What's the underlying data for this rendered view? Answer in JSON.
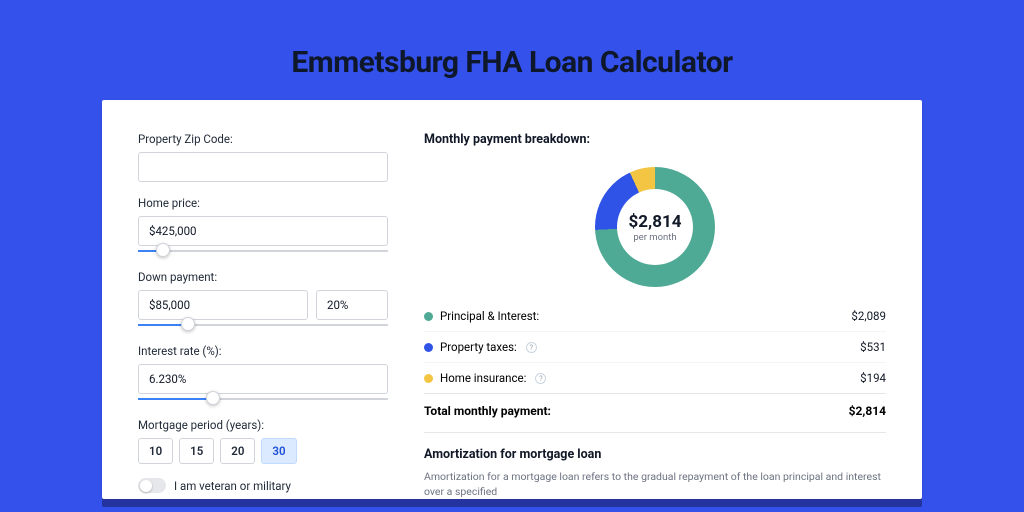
{
  "title": "Emmetsburg FHA Loan Calculator",
  "labels": {
    "zip": "Property Zip Code:",
    "home_price": "Home price:",
    "down_payment": "Down payment:",
    "interest_rate": "Interest rate (%):",
    "mortgage_period": "Mortgage period (years):",
    "veteran": "I am veteran or military"
  },
  "inputs": {
    "zip": "",
    "home_price": "$425,000",
    "down_payment": "$85,000",
    "down_payment_pct": "20%",
    "interest_rate": "6.230%"
  },
  "sliders": {
    "home_price_pct": 10,
    "down_payment_pct": 20,
    "interest_rate_pct": 30
  },
  "periods": [
    "10",
    "15",
    "20",
    "30"
  ],
  "period_active": "30",
  "colors": {
    "principal": "#4ea995",
    "taxes": "#2e53e6",
    "insurance": "#f4c542"
  },
  "breakdown": {
    "title": "Monthly payment breakdown:",
    "total": "$2,814",
    "total_sub": "per month",
    "items": [
      {
        "key": "principal",
        "label": "Principal & Interest:",
        "value": "$2,089",
        "info": false
      },
      {
        "key": "taxes",
        "label": "Property taxes:",
        "value": "$531",
        "info": true
      },
      {
        "key": "insurance",
        "label": "Home insurance:",
        "value": "$194",
        "info": true
      }
    ],
    "total_label": "Total monthly payment:",
    "total_value": "$2,814"
  },
  "amort": {
    "title": "Amortization for mortgage loan",
    "text": "Amortization for a mortgage loan refers to the gradual repayment of the loan principal and interest over a specified"
  },
  "chart_data": {
    "type": "pie",
    "title": "Monthly payment breakdown",
    "series": [
      {
        "name": "Principal & Interest",
        "value": 2089,
        "color": "#4ea995"
      },
      {
        "name": "Property taxes",
        "value": 531,
        "color": "#2e53e6"
      },
      {
        "name": "Home insurance",
        "value": 194,
        "color": "#f4c542"
      }
    ],
    "total": 2814,
    "unit": "$ per month"
  }
}
